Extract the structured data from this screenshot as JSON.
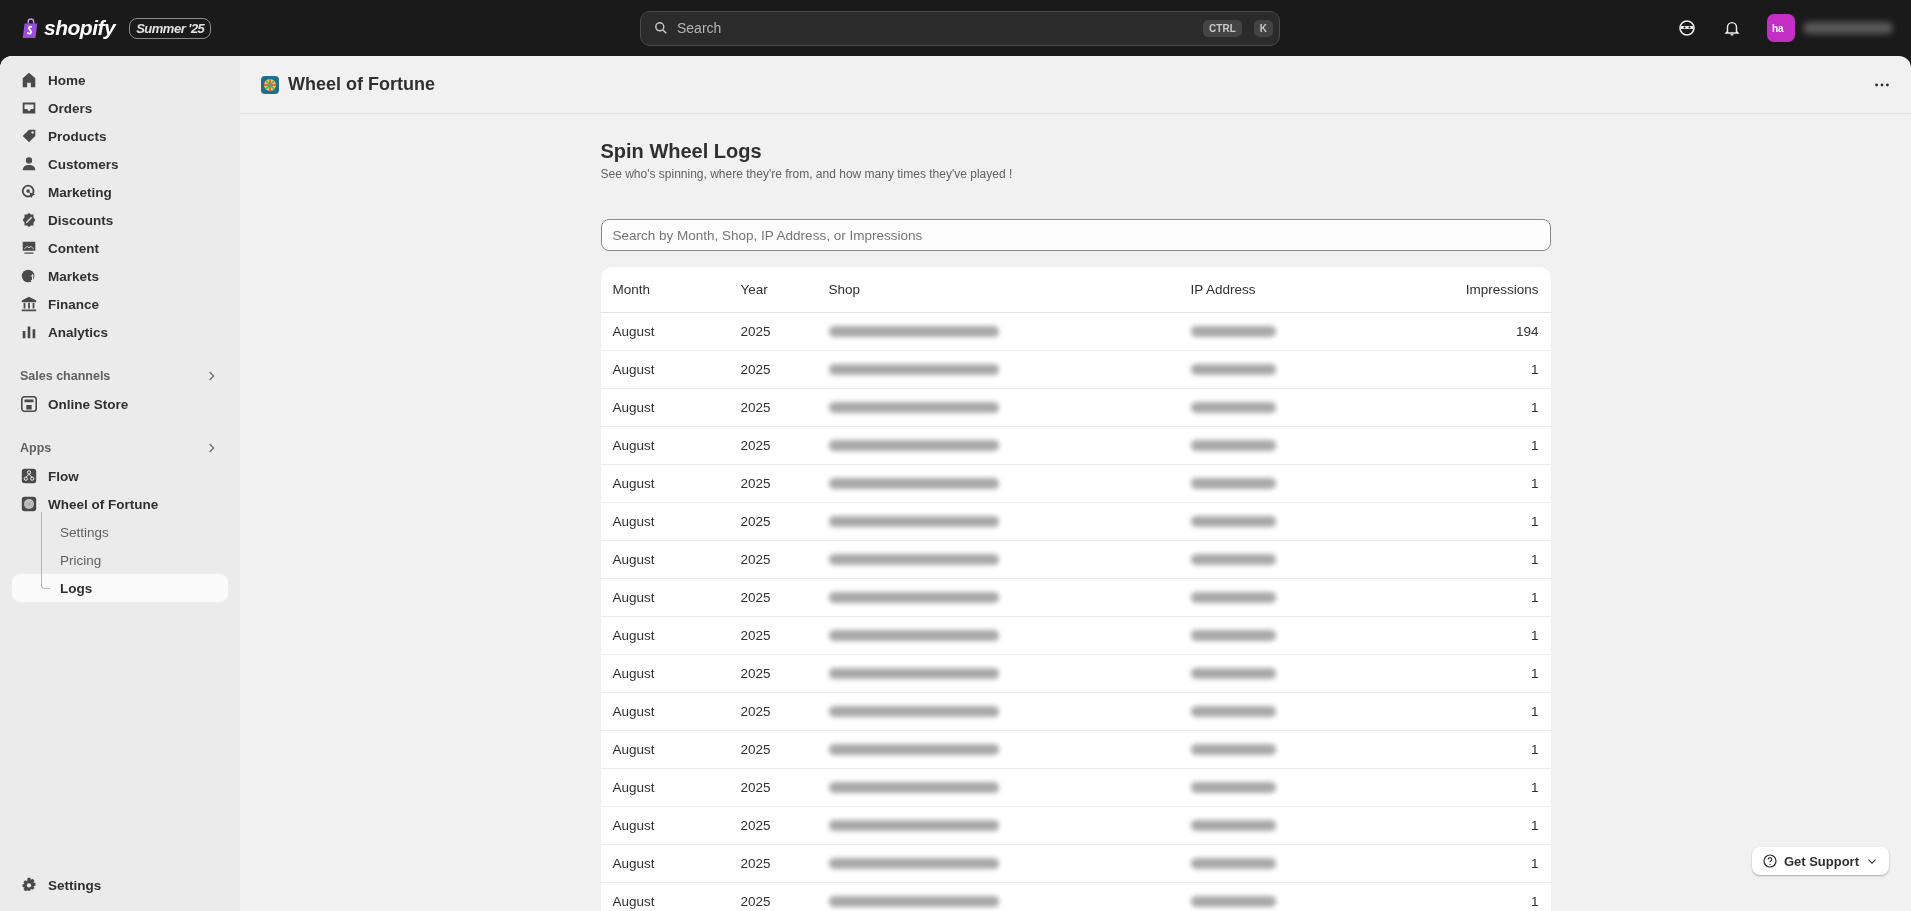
{
  "topbar": {
    "brand": "shopify",
    "edition_badge": "Summer '25",
    "search": {
      "placeholder": "Search",
      "shortcut_keys": [
        "CTRL",
        "K"
      ]
    },
    "avatar_initials": "ha"
  },
  "sidebar": {
    "items": [
      {
        "label": "Home"
      },
      {
        "label": "Orders"
      },
      {
        "label": "Products"
      },
      {
        "label": "Customers"
      },
      {
        "label": "Marketing"
      },
      {
        "label": "Discounts"
      },
      {
        "label": "Content"
      },
      {
        "label": "Markets"
      },
      {
        "label": "Finance"
      },
      {
        "label": "Analytics"
      }
    ],
    "sections": [
      {
        "title": "Sales channels",
        "items": [
          {
            "label": "Online Store"
          }
        ]
      },
      {
        "title": "Apps",
        "items": [
          {
            "label": "Flow"
          },
          {
            "label": "Wheel of Fortune",
            "children": [
              {
                "label": "Settings",
                "selected": false
              },
              {
                "label": "Pricing",
                "selected": false
              },
              {
                "label": "Logs",
                "selected": true
              }
            ]
          }
        ]
      }
    ],
    "footer_item": "Settings"
  },
  "app_title": "Wheel of Fortune",
  "page": {
    "title": "Spin Wheel Logs",
    "subtitle": "See who's spinning, where they're from, and how many times they've played !",
    "search": {
      "placeholder": "Search by Month, Shop, IP Address, or Impressions"
    },
    "table": {
      "columns": [
        "Month",
        "Year",
        "Shop",
        "IP Address",
        "Impressions"
      ],
      "rows": [
        {
          "month": "August",
          "year": "2025",
          "impressions": "194"
        },
        {
          "month": "August",
          "year": "2025",
          "impressions": "1"
        },
        {
          "month": "August",
          "year": "2025",
          "impressions": "1"
        },
        {
          "month": "August",
          "year": "2025",
          "impressions": "1"
        },
        {
          "month": "August",
          "year": "2025",
          "impressions": "1"
        },
        {
          "month": "August",
          "year": "2025",
          "impressions": "1"
        },
        {
          "month": "August",
          "year": "2025",
          "impressions": "1"
        },
        {
          "month": "August",
          "year": "2025",
          "impressions": "1"
        },
        {
          "month": "August",
          "year": "2025",
          "impressions": "1"
        },
        {
          "month": "August",
          "year": "2025",
          "impressions": "1"
        },
        {
          "month": "August",
          "year": "2025",
          "impressions": "1"
        },
        {
          "month": "August",
          "year": "2025",
          "impressions": "1"
        },
        {
          "month": "August",
          "year": "2025",
          "impressions": "1"
        },
        {
          "month": "August",
          "year": "2025",
          "impressions": "1"
        },
        {
          "month": "August",
          "year": "2025",
          "impressions": "1"
        },
        {
          "month": "August",
          "year": "2025",
          "impressions": "1"
        }
      ]
    }
  },
  "support_button": "Get Support"
}
